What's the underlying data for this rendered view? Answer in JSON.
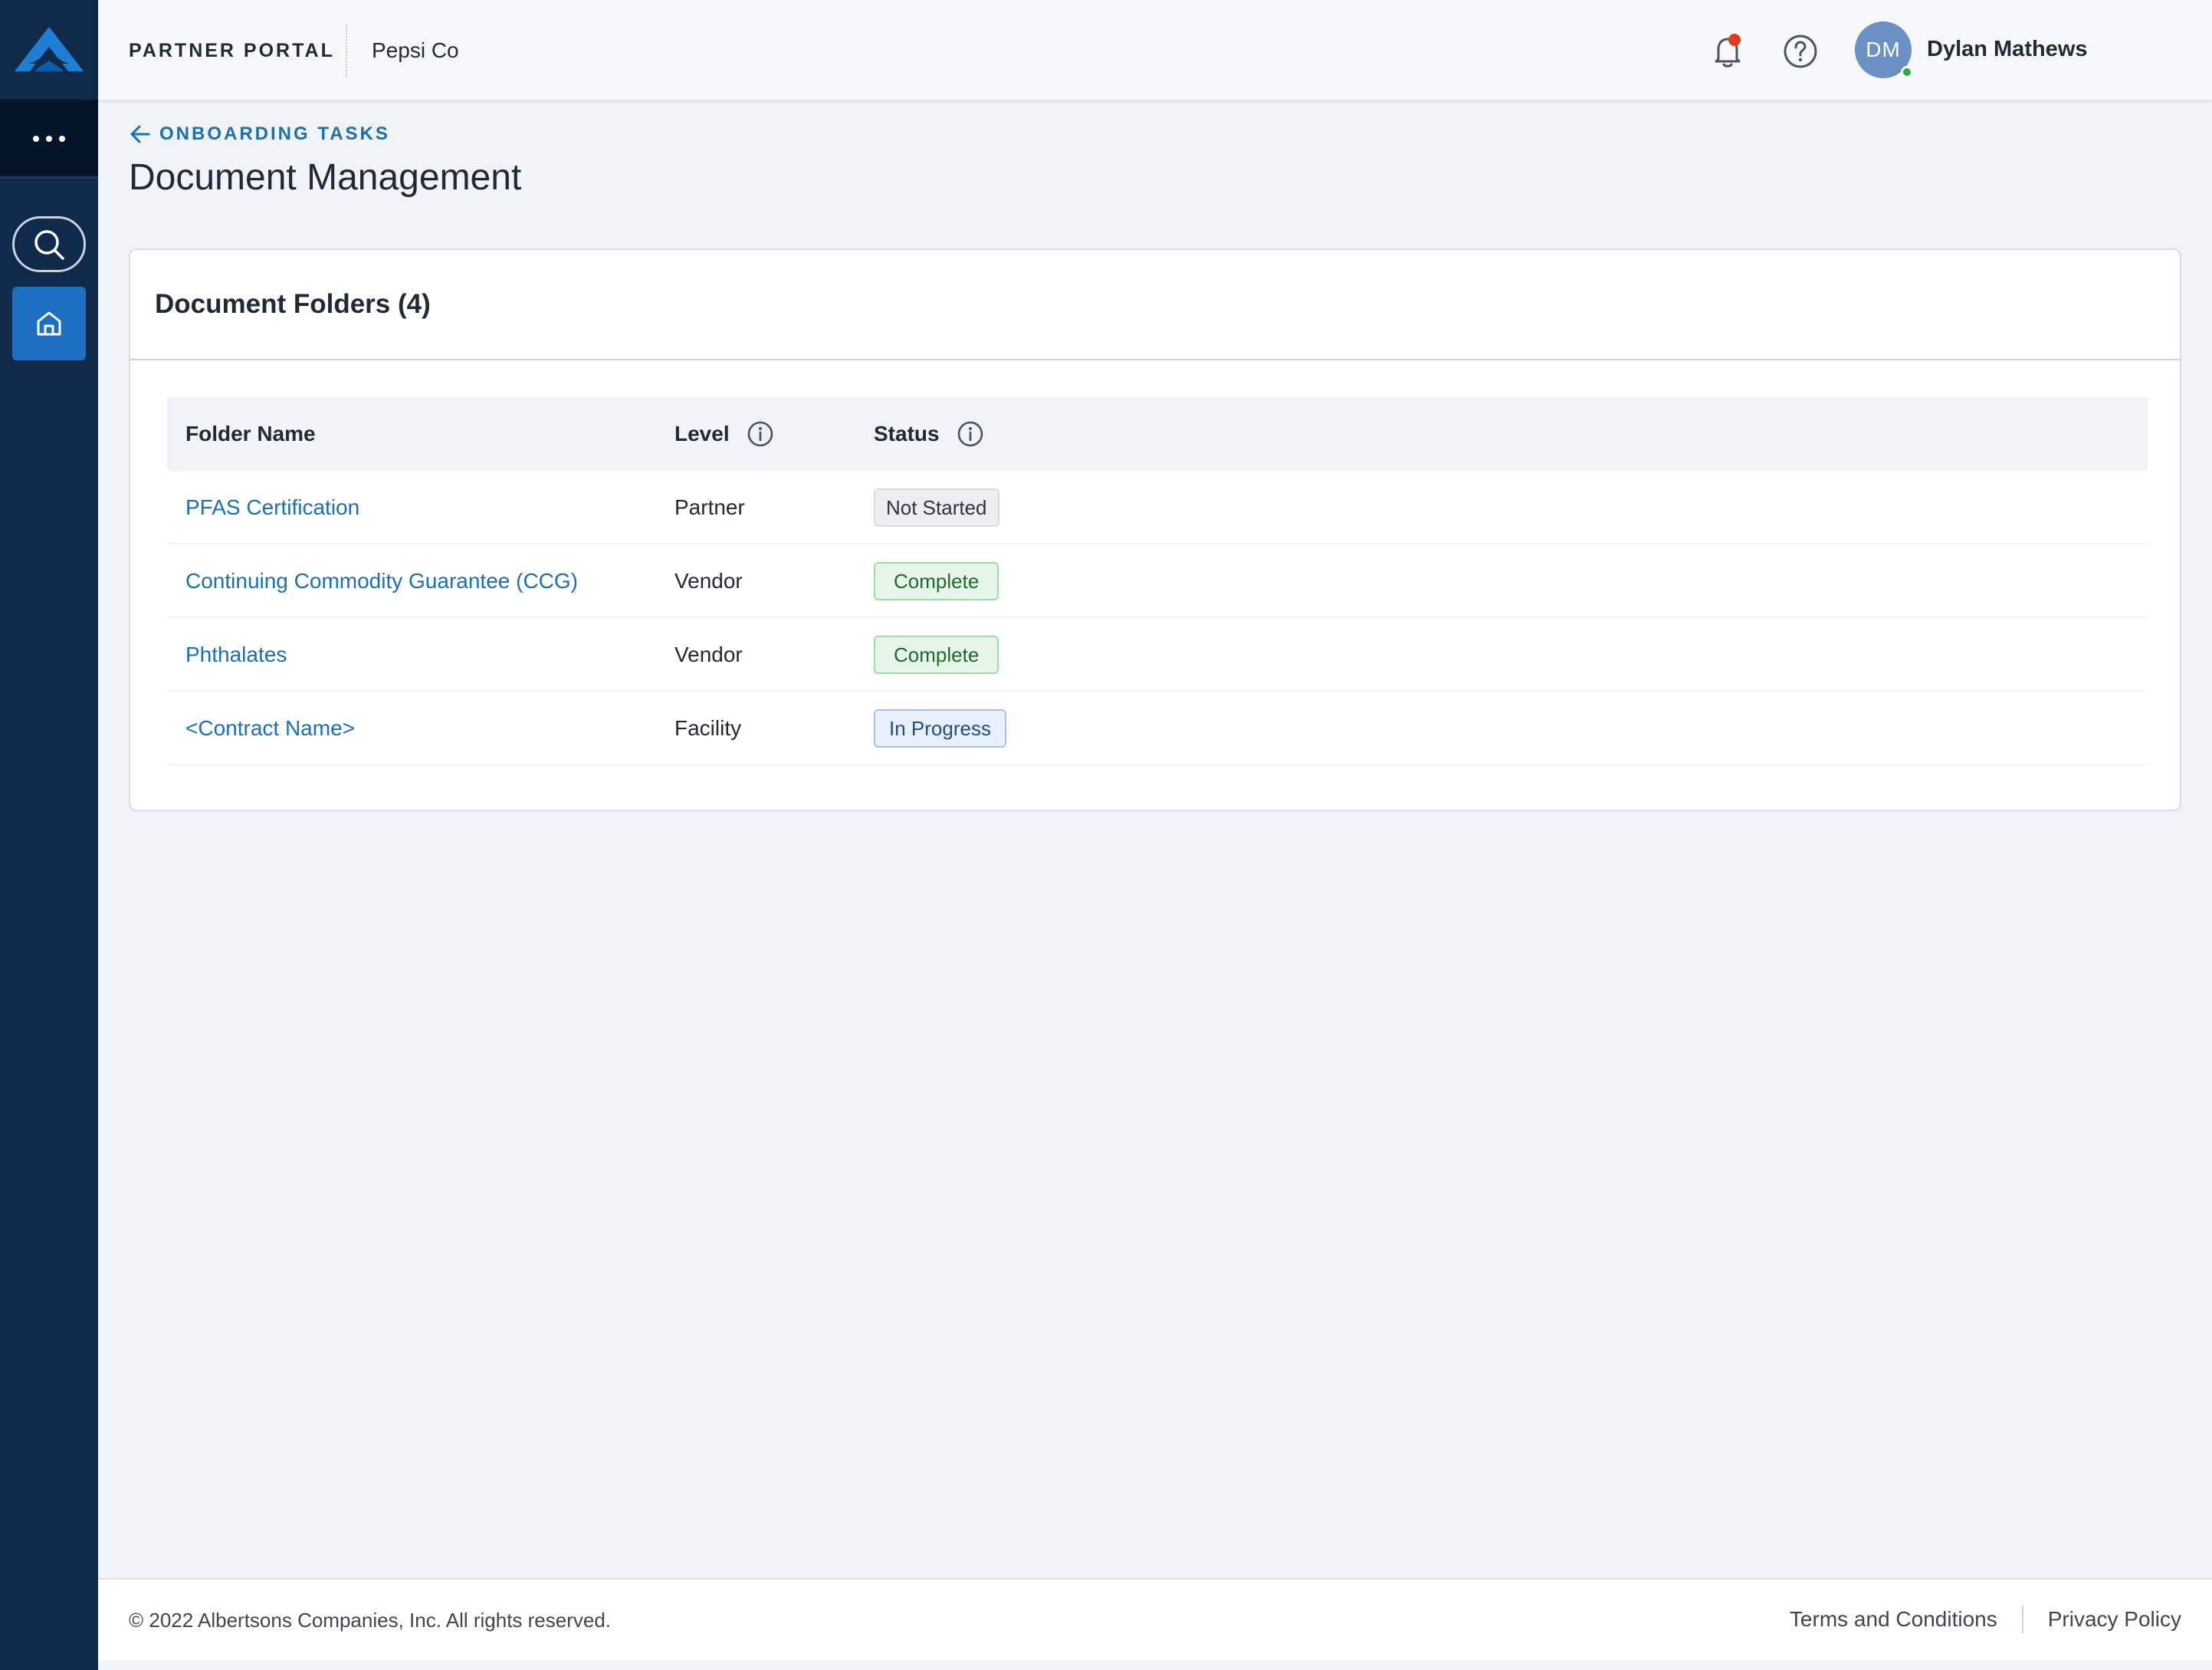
{
  "header": {
    "portal_label": "PARTNER PORTAL",
    "company": "Pepsi Co",
    "user_initials": "DM",
    "user_name": "Dylan Mathews"
  },
  "breadcrumb": {
    "back_label": "ONBOARDING TASKS"
  },
  "page": {
    "title": "Document Management"
  },
  "card": {
    "title": "Document Folders (4)",
    "columns": {
      "folder_name": "Folder Name",
      "level": "Level",
      "status": "Status"
    },
    "rows": [
      {
        "folder": "PFAS Certification",
        "level": "Partner",
        "status": "Not Started",
        "status_type": "not-started"
      },
      {
        "folder": "Continuing Commodity Guarantee (CCG)",
        "level": "Vendor",
        "status": "Complete",
        "status_type": "complete"
      },
      {
        "folder": "Phthalates",
        "level": "Vendor",
        "status": "Complete",
        "status_type": "complete"
      },
      {
        "folder": "<Contract Name>",
        "level": "Facility",
        "status": "In Progress",
        "status_type": "in-progress"
      }
    ]
  },
  "footer": {
    "copyright": "© 2022 Albertsons Companies, Inc. All rights reserved.",
    "terms": "Terms and Conditions",
    "privacy": "Privacy Policy"
  },
  "icons": {
    "logo": "albertsons-logo-icon",
    "more": "more-horizontal-icon",
    "search": "search-icon",
    "home": "home-icon",
    "bell": "bell-icon",
    "help": "help-circle-icon",
    "back": "arrow-left-icon",
    "info": "info-icon"
  },
  "colors": {
    "sidebar": "#0f2a4a",
    "accent": "#1c6fc1",
    "link": "#1a6fb5",
    "notification": "#e03a1a",
    "online": "#2ca84a"
  }
}
